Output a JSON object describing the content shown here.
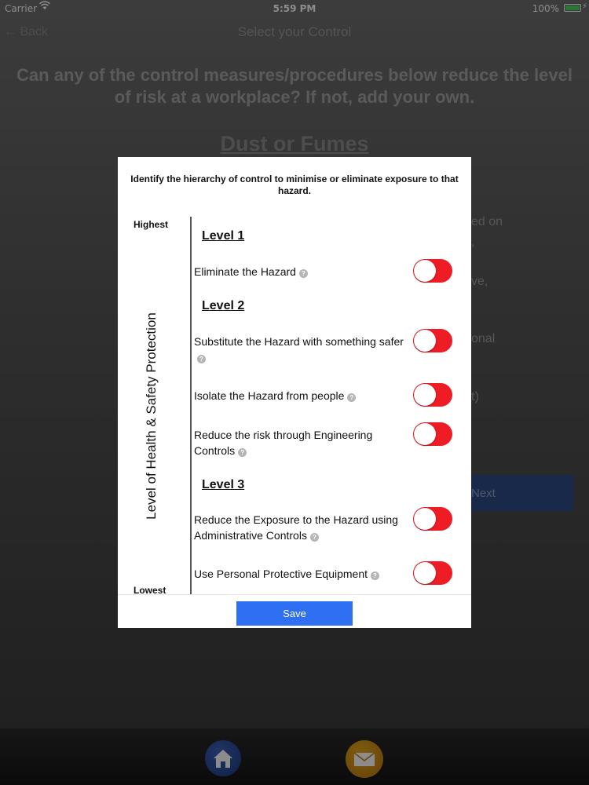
{
  "status_bar": {
    "carrier": "Carrier",
    "time": "5:59 PM",
    "battery_pct": "100%",
    "battery_color": "#4cd964"
  },
  "nav": {
    "back_label": "← Back",
    "title": "Select your Control"
  },
  "page": {
    "question": "Can any of the control measures/procedures below reduce the level of risk at a workplace? If not, add your own.",
    "hazard_title": "Dust or Fumes",
    "background_fragments": [
      "ed on",
      ",",
      "ve,",
      "onal",
      "t)"
    ],
    "next_label": "Next"
  },
  "modal": {
    "heading": "Identify the hierarchy of control to minimise or eliminate exposure to that hazard.",
    "axis_highest": "Highest",
    "axis_lowest": "Lowest",
    "axis_label": "Level of Health & Safety Protection",
    "levels": [
      "Level 1",
      "Level 2",
      "Level 3"
    ],
    "controls": [
      {
        "label": "Eliminate the Hazard",
        "enabled": false
      },
      {
        "label": "Substitute the Hazard with something safer",
        "enabled": false
      },
      {
        "label": "Isolate the Hazard from people",
        "enabled": false
      },
      {
        "label": "Reduce the risk through Engineering Controls",
        "enabled": false
      },
      {
        "label": "Reduce the Exposure to the Hazard using Administrative Controls",
        "enabled": false
      },
      {
        "label": "Use Personal Protective Equipment",
        "enabled": false
      }
    ],
    "help_glyph": "?",
    "toggle_off_color": "#ee1c25",
    "save_label": "Save",
    "save_color": "#2f6ff2"
  },
  "bottom_bar": {
    "home_icon": "home-icon",
    "mail_icon": "mail-icon"
  }
}
